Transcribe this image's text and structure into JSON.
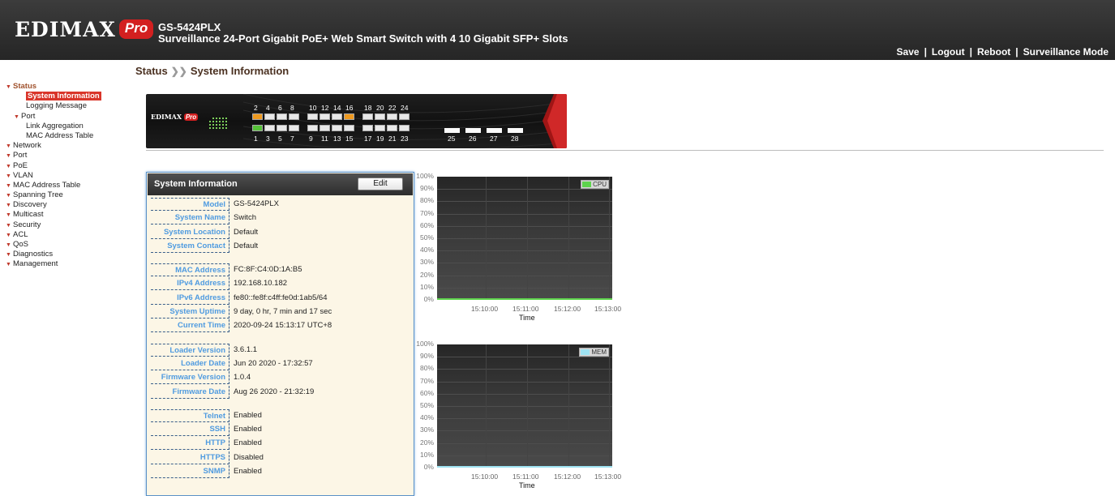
{
  "header": {
    "brand": "EDIMAX",
    "brand_badge": "Pro",
    "model": "GS-5424PLX",
    "description": "Surveillance 24-Port Gigabit PoE+ Web Smart Switch with 4 10 Gigabit SFP+ Slots",
    "links": [
      "Save",
      "Logout",
      "Reboot",
      "Surveillance Mode"
    ]
  },
  "breadcrumb": {
    "section": "Status",
    "page": "System Information"
  },
  "sidebar": {
    "status": "Status",
    "status_children": [
      "System Information",
      "Logging Message"
    ],
    "port": "Port",
    "port_children": [
      "Link Aggregation",
      "MAC Address Table"
    ],
    "items": [
      "Network",
      "Port",
      "PoE",
      "VLAN",
      "MAC Address Table",
      "Spanning Tree",
      "Discovery",
      "Multicast",
      "Security",
      "ACL",
      "QoS",
      "Diagnostics",
      "Management"
    ]
  },
  "device": {
    "logo": "EDIMAX",
    "logo_badge": "Pro",
    "top_ports": [
      "2",
      "4",
      "6",
      "8",
      "10",
      "12",
      "14",
      "16",
      "18",
      "20",
      "22",
      "24"
    ],
    "bottom_ports": [
      "1",
      "3",
      "5",
      "7",
      "9",
      "11",
      "13",
      "15",
      "17",
      "19",
      "21",
      "23"
    ],
    "sfp_ports": [
      "25",
      "26",
      "27",
      "28"
    ],
    "active_top": [
      "2",
      "16"
    ],
    "active_bottom": [
      "1"
    ]
  },
  "system_info": {
    "title": "System Information",
    "edit_label": "Edit",
    "groups": [
      [
        {
          "label": "Model",
          "value": "GS-5424PLX"
        },
        {
          "label": "System Name",
          "value": "Switch"
        },
        {
          "label": "System Location",
          "value": "Default"
        },
        {
          "label": "System Contact",
          "value": "Default"
        }
      ],
      [
        {
          "label": "MAC Address",
          "value": "FC:8F:C4:0D:1A:B5"
        },
        {
          "label": "IPv4 Address",
          "value": "192.168.10.182"
        },
        {
          "label": "IPv6 Address",
          "value": "fe80::fe8f:c4ff:fe0d:1ab5/64"
        },
        {
          "label": "System Uptime",
          "value": "9 day, 0 hr, 7 min and 17 sec"
        },
        {
          "label": "Current Time",
          "value": "2020-09-24 15:13:17 UTC+8"
        }
      ],
      [
        {
          "label": "Loader Version",
          "value": "3.6.1.1"
        },
        {
          "label": "Loader Date",
          "value": "Jun 20 2020 - 17:32:57"
        },
        {
          "label": "Firmware Version",
          "value": "1.0.4"
        },
        {
          "label": "Firmware Date",
          "value": "Aug 26 2020 - 21:32:19"
        }
      ],
      [
        {
          "label": "Telnet",
          "value": "Enabled"
        },
        {
          "label": "SSH",
          "value": "Enabled"
        },
        {
          "label": "HTTP",
          "value": "Enabled"
        },
        {
          "label": "HTTPS",
          "value": "Disabled"
        },
        {
          "label": "SNMP",
          "value": "Enabled"
        }
      ]
    ]
  },
  "chart_data": [
    {
      "type": "line",
      "series": [
        {
          "name": "CPU",
          "color": "#5ed44d",
          "values": [
            0,
            0,
            0,
            0,
            0
          ]
        }
      ],
      "y_ticks": [
        "100%",
        "90%",
        "80%",
        "70%",
        "60%",
        "50%",
        "40%",
        "30%",
        "20%",
        "10%",
        "0%"
      ],
      "ylim": [
        0,
        100
      ],
      "x_ticks": [
        "15:10:00",
        "15:11:00",
        "15:12:00",
        "15:13:00"
      ],
      "xlabel": "Time",
      "legend": "top-right"
    },
    {
      "type": "line",
      "series": [
        {
          "name": "MEM",
          "color": "#9fe3f2",
          "values": [
            0,
            0,
            0,
            0,
            0
          ]
        }
      ],
      "y_ticks": [
        "100%",
        "90%",
        "80%",
        "70%",
        "60%",
        "50%",
        "40%",
        "30%",
        "20%",
        "10%",
        "0%"
      ],
      "ylim": [
        0,
        100
      ],
      "x_ticks": [
        "15:10:00",
        "15:11:00",
        "15:12:00",
        "15:13:00"
      ],
      "xlabel": "Time",
      "legend": "top-right"
    }
  ]
}
